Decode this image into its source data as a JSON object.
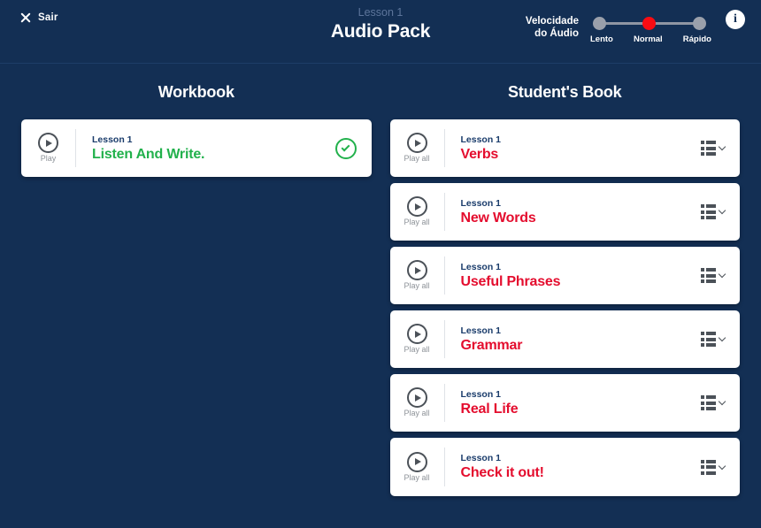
{
  "header": {
    "exit_label": "Sair",
    "exit_icon": "close-x-icon",
    "subtitle": "Lesson 1",
    "title": "Audio Pack",
    "info_icon": "info-icon",
    "info_glyph": "i",
    "speed": {
      "label_line1": "Velocidade",
      "label_line2": "do Áudio",
      "ticks": [
        "Lento",
        "Normal",
        "Rápido"
      ],
      "selected": "Normal",
      "selected_index": 1,
      "active_color": "#f90c12",
      "inactive_color": "#9aa0ab"
    }
  },
  "colors": {
    "background": "#132f54",
    "card_bg": "#ffffff",
    "lesson_label": "#1a3c6b",
    "track_red": "#e40d2e",
    "done_green": "#22b14c"
  },
  "columns": [
    {
      "title": "Workbook",
      "cards": [
        {
          "play_label": "Play",
          "play_icon": "play-icon",
          "lesson": "Lesson 1",
          "name": "Listen And Write.",
          "name_color": "green",
          "trailing": "check",
          "trailing_icon": "check-circle-icon"
        }
      ]
    },
    {
      "title": "Student's Book",
      "cards": [
        {
          "play_label": "Play all",
          "play_icon": "play-icon",
          "lesson": "Lesson 1",
          "name": "Verbs",
          "name_color": "red",
          "trailing": "list",
          "trailing_icon": "track-list-icon"
        },
        {
          "play_label": "Play all",
          "play_icon": "play-icon",
          "lesson": "Lesson 1",
          "name": "New Words",
          "name_color": "red",
          "trailing": "list",
          "trailing_icon": "track-list-icon"
        },
        {
          "play_label": "Play all",
          "play_icon": "play-icon",
          "lesson": "Lesson 1",
          "name": "Useful Phrases",
          "name_color": "red",
          "trailing": "list",
          "trailing_icon": "track-list-icon"
        },
        {
          "play_label": "Play all",
          "play_icon": "play-icon",
          "lesson": "Lesson 1",
          "name": "Grammar",
          "name_color": "red",
          "trailing": "list",
          "trailing_icon": "track-list-icon"
        },
        {
          "play_label": "Play all",
          "play_icon": "play-icon",
          "lesson": "Lesson 1",
          "name": "Real Life",
          "name_color": "red",
          "trailing": "list",
          "trailing_icon": "track-list-icon"
        },
        {
          "play_label": "Play all",
          "play_icon": "play-icon",
          "lesson": "Lesson 1",
          "name": "Check it out!",
          "name_color": "red",
          "trailing": "list",
          "trailing_icon": "track-list-icon"
        }
      ]
    }
  ]
}
